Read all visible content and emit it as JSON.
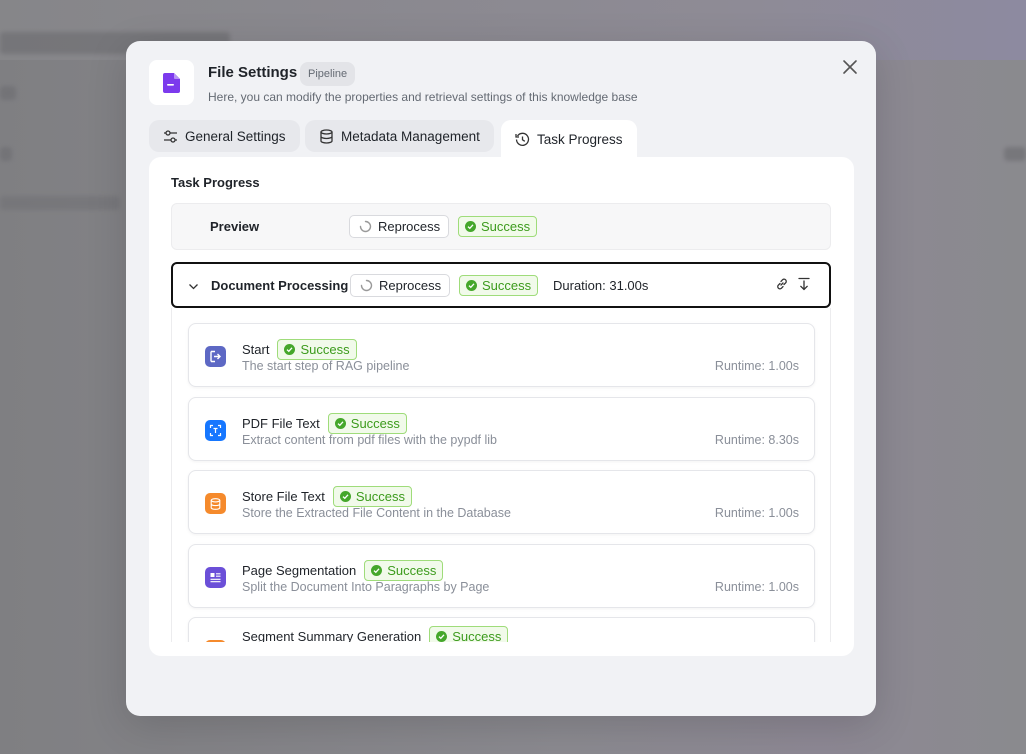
{
  "dialog": {
    "title": "File Settings",
    "badge": "Pipeline",
    "subtitle": "Here, you can modify the properties and retrieval settings of this knowledge base"
  },
  "tabs": [
    {
      "label": "General Settings",
      "icon": "sliders-icon"
    },
    {
      "label": "Metadata Management",
      "icon": "database-icon"
    },
    {
      "label": "Task Progress",
      "icon": "history-icon"
    }
  ],
  "panel": {
    "title": "Task Progress",
    "preview": {
      "label": "Preview",
      "reprocess": "Reprocess",
      "status": "Success"
    },
    "document_processing": {
      "label": "Document Processing",
      "reprocess": "Reprocess",
      "status": "Success",
      "duration": "Duration: 31.00s"
    },
    "steps": [
      {
        "name": "Start",
        "status": "Success",
        "description": "The start step of RAG pipeline",
        "runtime": "Runtime: 1.00s",
        "icon": "start-icon",
        "color": "#5d68c4"
      },
      {
        "name": "PDF File Text",
        "status": "Success",
        "description": "Extract content from pdf files with the pypdf lib",
        "runtime": "Runtime: 8.30s",
        "icon": "text-extract-icon",
        "color": "#1677ff"
      },
      {
        "name": "Store File Text",
        "status": "Success",
        "description": "Store the Extracted File Content in the Database",
        "runtime": "Runtime: 1.00s",
        "icon": "database-icon",
        "color": "#f58a2c"
      },
      {
        "name": "Page Segmentation",
        "status": "Success",
        "description": "Split the Document Into Paragraphs by Page",
        "runtime": "Runtime: 1.00s",
        "icon": "segment-icon",
        "color": "#6b4fd8"
      },
      {
        "name": "Segment Summary Generation",
        "status": "Success",
        "description": "",
        "runtime": "",
        "icon": "summary-icon",
        "color": "#f58a2c"
      }
    ]
  },
  "colors": {
    "success_text": "#3c9b1c",
    "success_bg": "#f1faea",
    "success_border": "#9fdc7a",
    "file_icon": "#7c3aed"
  }
}
